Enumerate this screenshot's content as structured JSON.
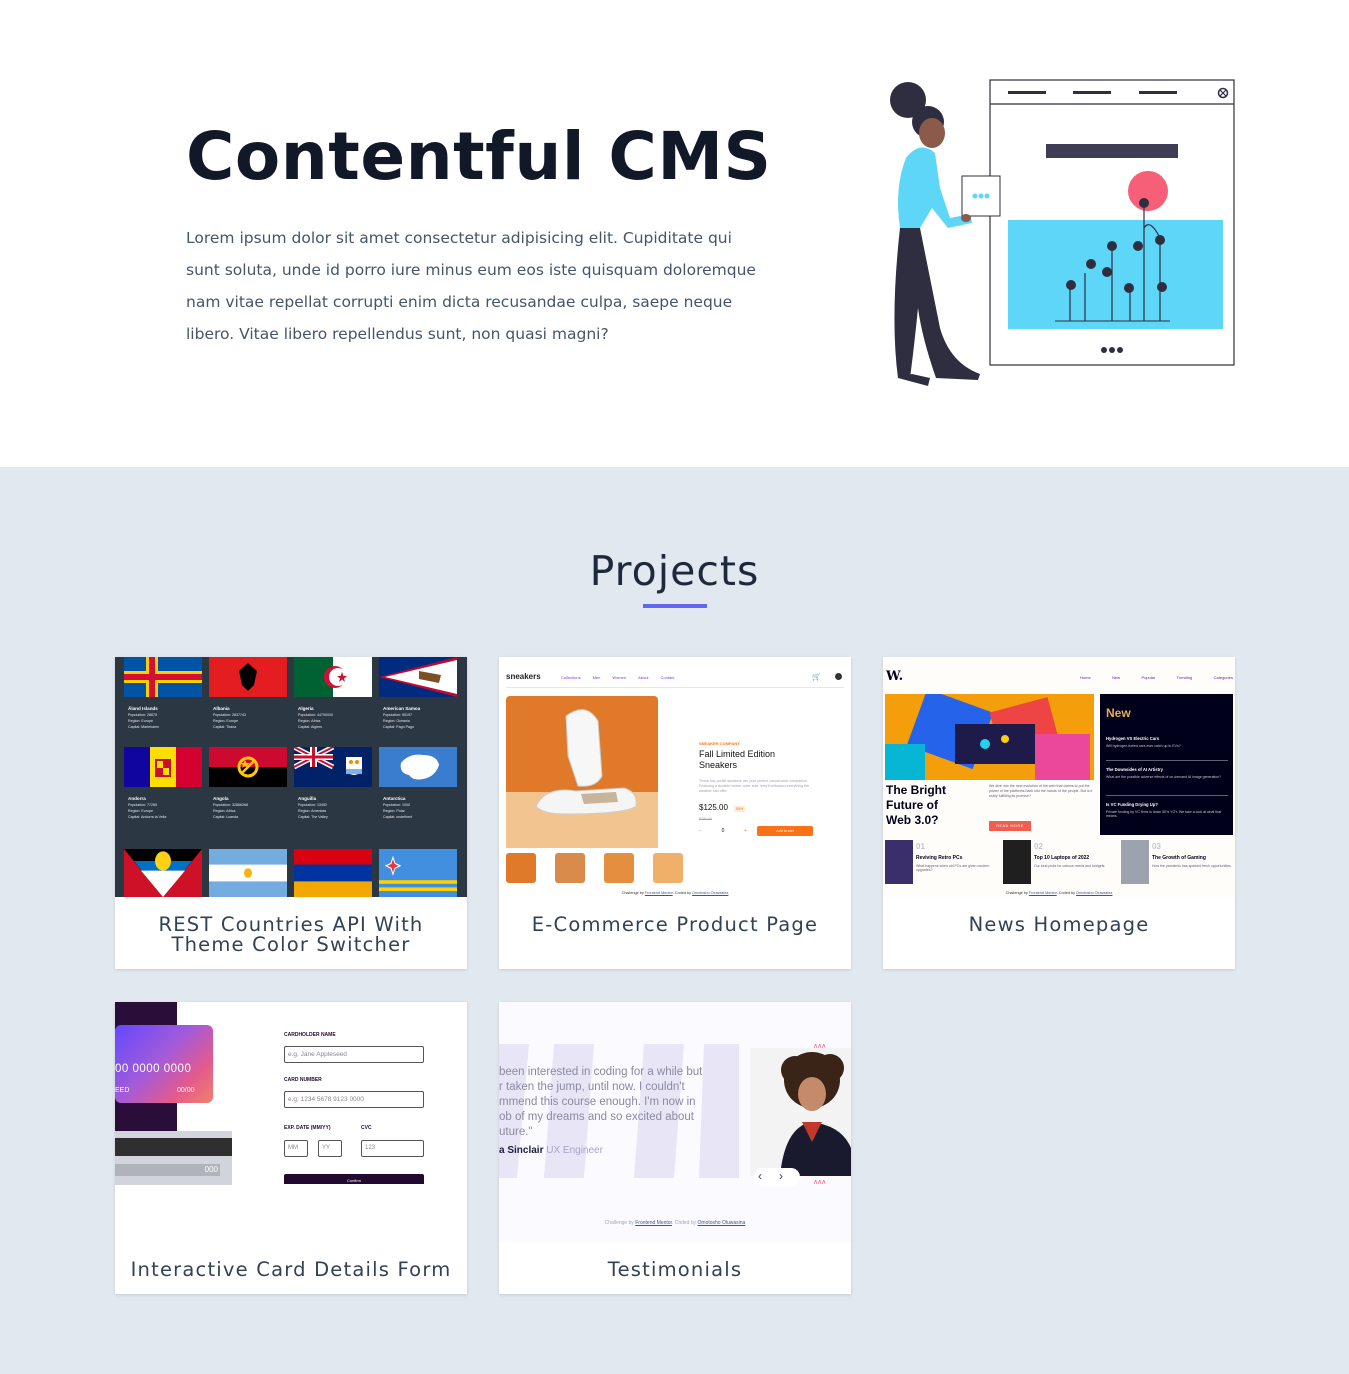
{
  "hero": {
    "title": "Contentful CMS",
    "text": "Lorem ipsum dolor sit amet consectetur adipisicing elit. Cupiditate qui sunt soluta, unde id porro iure minus eum eos iste quisquam doloremque nam vitae repellat corrupti enim dicta recusandae culpa, saepe neque libero. Vitae libero repellendus sunt, non quasi magni?"
  },
  "projects": {
    "title": "Projects",
    "cards": [
      {
        "label": "REST Countries API With Theme Color Switcher"
      },
      {
        "label": "E-Commerce Product Page"
      },
      {
        "label": "News Homepage"
      },
      {
        "label": "Interactive Card Details Form"
      },
      {
        "label": "Testimonials"
      }
    ]
  },
  "thumbs": {
    "countries": [
      {
        "name": "Åland Islands",
        "l1": "Population: 28875",
        "l2": "Region: Europe",
        "l3": "Capital: Mariehamn"
      },
      {
        "name": "Albania",
        "l1": "Population: 2837743",
        "l2": "Region: Europe",
        "l3": "Capital: Tirana"
      },
      {
        "name": "Algeria",
        "l1": "Population: 44700000",
        "l2": "Region: Africa",
        "l3": "Capital: Algiers"
      },
      {
        "name": "American Samoa",
        "l1": "Population: 55197",
        "l2": "Region: Oceania",
        "l3": "Capital: Pago Pago"
      },
      {
        "name": "Andorra",
        "l1": "Population: 77265",
        "l2": "Region: Europe",
        "l3": "Capital: Andorra la Vella"
      },
      {
        "name": "Angola",
        "l1": "Population: 32866268",
        "l2": "Region: Africa",
        "l3": "Capital: Luanda"
      },
      {
        "name": "Anguilla",
        "l1": "Population: 13452",
        "l2": "Region: Americas",
        "l3": "Capital: The Valley"
      },
      {
        "name": "Antarctica",
        "l1": "Population: 1000",
        "l2": "Region: Polar",
        "l3": "Capital: undefined"
      }
    ],
    "ecommerce": {
      "logo": "sneakers",
      "nav": [
        "Collections",
        "Men",
        "Women",
        "About",
        "Contact"
      ],
      "company": "SNEAKER COMPANY",
      "product": "Fall Limited Edition Sneakers",
      "desc": "These low-profile sneakers are your perfect casual wear companion. Featuring a durable rubber outer sole, they'll withstand everything the weather can offer.",
      "price": "$125.00",
      "discount": "50%",
      "old_price": "$250.00",
      "minus": "−",
      "qty": "0",
      "plus": "+",
      "add": "Add to cart",
      "challenge": "Challenge by",
      "fm": "Frontend Mentor",
      "coded": ". Coded by",
      "author": "Omotosho Oluwasina"
    },
    "news": {
      "logo": "W.",
      "nav": [
        "Home",
        "New",
        "Popular",
        "Trending",
        "Categories"
      ],
      "headline": "The Bright Future of Web 3.0?",
      "intro": "We dive into the next evolution of the web that claims to put the power of the platforms back into the hands of the people. But is it really fulfilling its promise?",
      "read_more": "READ MORE",
      "new_title": "New",
      "new_items": [
        {
          "title": "Hydrogen VS Electric Cars",
          "text": "Will hydrogen-fueled cars ever catch up to EVs?"
        },
        {
          "title": "The Downsides of AI Artistry",
          "text": "What are the possible adverse effects of on-demand AI image generation?"
        },
        {
          "title": "Is VC Funding Drying Up?",
          "text": "Private funding by VC firms is down 50% YOY. We take a look at what that means."
        }
      ],
      "bottom": [
        {
          "num": "01",
          "title": "Reviving Retro PCs",
          "text": "What happens when old PCs are given modern upgrades?"
        },
        {
          "num": "02",
          "title": "Top 10 Laptops of 2022",
          "text": "Our best picks for various needs and budgets."
        },
        {
          "num": "03",
          "title": "The Growth of Gaming",
          "text": "How the pandemic has sparked fresh opportunities."
        }
      ],
      "challenge": "Challenge by",
      "fm": "Frontend Mentor",
      "coded": ". Coded by",
      "author": "Omotosho Oluwasina"
    },
    "cardform": {
      "card_number": "00 0000 0000",
      "card_name": "EED",
      "card_exp": "00/00",
      "cvc_back": "000",
      "holder_label": "CARDHOLDER NAME",
      "holder_placeholder": "e.g. Jane Appleseed",
      "number_label": "CARD NUMBER",
      "number_placeholder": "e.g. 1234 5678 9123 0000",
      "exp_label": "EXP. DATE (MM/YY)",
      "cvc_label": "CVC",
      "mm": "MM",
      "yy": "YY",
      "cvc_placeholder": "123",
      "confirm": "Confirm"
    },
    "testimonial": {
      "line1": "been interested in coding for a while but",
      "line2": "r taken the jump, until now. I couldn't",
      "line3": "mmend this course enough. I'm now in",
      "line4": "ob of my dreams and so excited about",
      "line5": "uture.\"",
      "name": "a Sinclair",
      "role": "UX Engineer",
      "prev": "‹",
      "next": "›",
      "challenge": "Challenge by",
      "fm": "Frontend Mentor",
      "coded": ". Coded by",
      "author": "Omotosho Oluwasina"
    }
  },
  "colors": {
    "accent": "#6366f1",
    "section_bg": "#e2e8f0",
    "illus_blue": "#5dd6f8",
    "illus_pink": "#f55f78",
    "illus_dark": "#2f2e41"
  }
}
